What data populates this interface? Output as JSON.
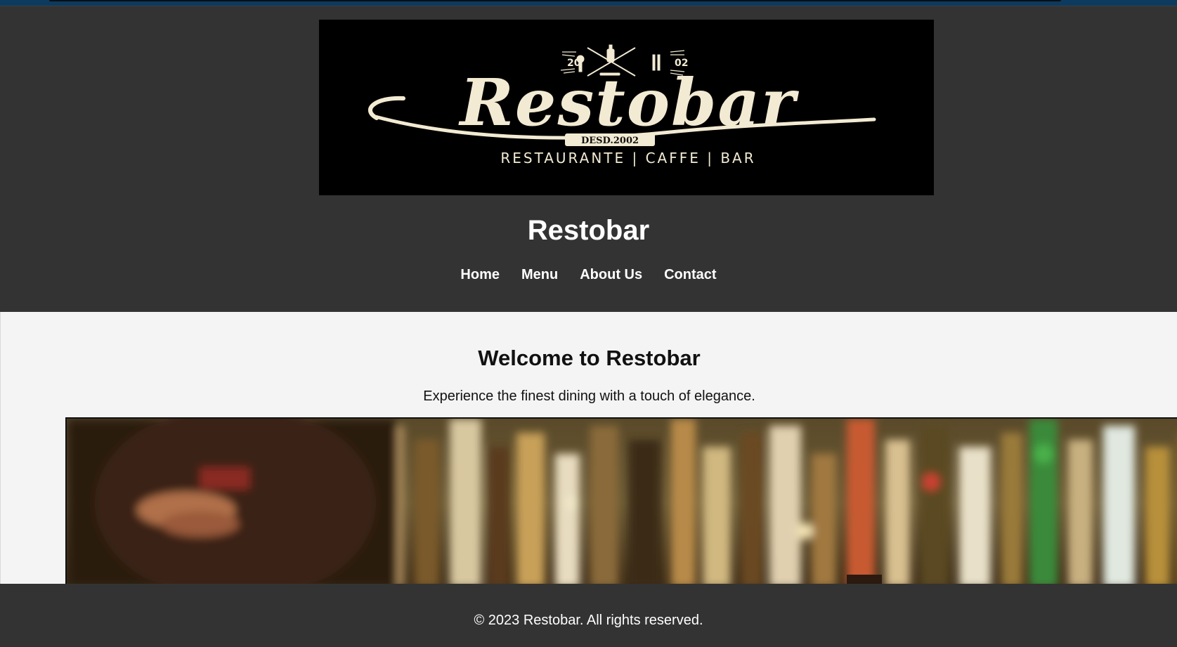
{
  "header": {
    "logo": {
      "year_left": "20",
      "year_right": "02",
      "wordmark": "Restobar",
      "established": "DESD.2002",
      "tagline": "RESTAURANTE | CAFFE | BAR"
    },
    "title": "Restobar"
  },
  "nav": {
    "items": [
      {
        "label": "Home"
      },
      {
        "label": "Menu"
      },
      {
        "label": "About Us"
      },
      {
        "label": "Contact"
      }
    ]
  },
  "main": {
    "welcome_title": "Welcome to Restobar",
    "welcome_text": "Experience the finest dining with a touch of elegance."
  },
  "footer": {
    "copyright": "© 2023 Restobar. All rights reserved."
  },
  "colors": {
    "header_bg": "#333333",
    "content_bg": "#f4f4f4",
    "logo_cream": "#f2ead2",
    "top_strip": "#0d3a5f"
  }
}
